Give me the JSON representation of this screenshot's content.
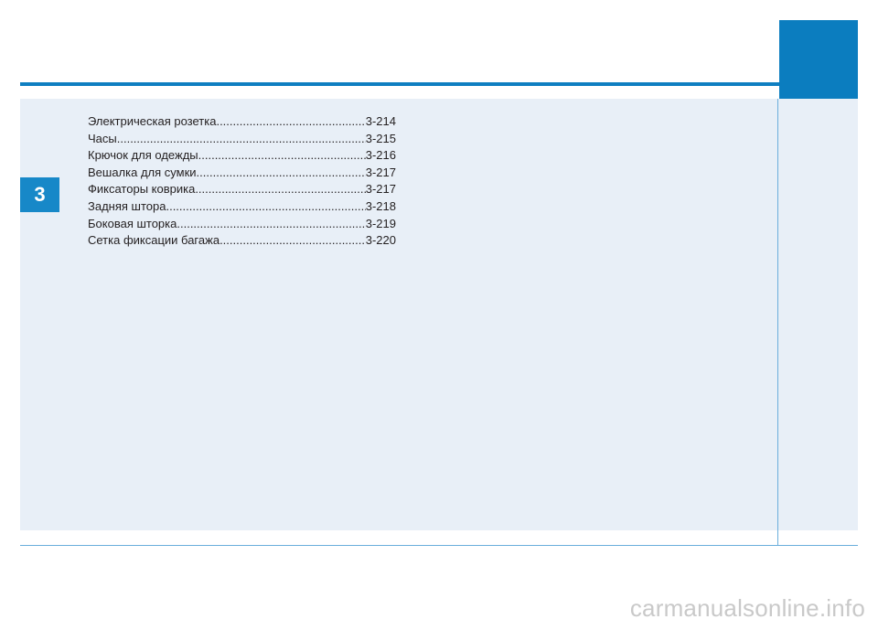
{
  "chapter": {
    "number": "3"
  },
  "toc": {
    "entries": [
      {
        "title": "Электрическая розетка",
        "page": "3-214"
      },
      {
        "title": "Часы",
        "page": "3-215"
      },
      {
        "title": "Крючок для одежды",
        "page": "3-216"
      },
      {
        "title": "Вешалка для сумки",
        "page": "3-217"
      },
      {
        "title": "Фиксаторы коврика",
        "page": "3-217"
      },
      {
        "title": "Задняя штора",
        "page": "3-218"
      },
      {
        "title": "Боковая шторка",
        "page": "3-219"
      },
      {
        "title": "Сетка фиксации багажа",
        "page": "3-220"
      }
    ]
  },
  "watermark": {
    "text": "carmanualsonline.info"
  },
  "colors": {
    "accent": "#0f7fc1",
    "panel": "#e8eff7",
    "divider": "#6aaedc"
  }
}
